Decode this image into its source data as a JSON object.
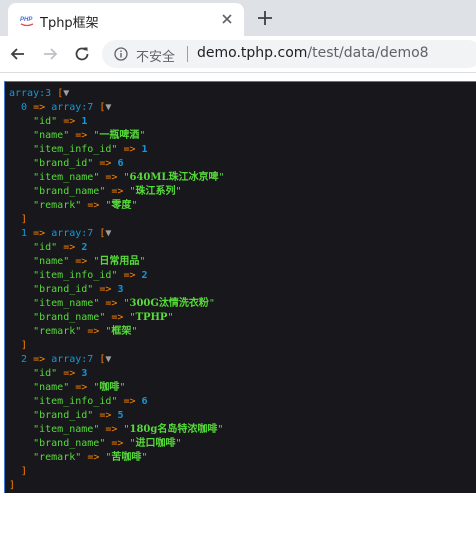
{
  "browser": {
    "tab_title": "Tphp框架",
    "favicon_text": "PHP",
    "security_label": "不安全",
    "url_host": "demo.tphp.com",
    "url_path": "/test/data/demo8"
  },
  "dump": {
    "root_type": "array:3",
    "items": [
      {
        "index": "0",
        "type": "array:7",
        "fields": [
          {
            "key": "id",
            "value": "1",
            "kind": "num"
          },
          {
            "key": "name",
            "value": "一瓶啤酒",
            "kind": "str"
          },
          {
            "key": "item_info_id",
            "value": "1",
            "kind": "num"
          },
          {
            "key": "brand_id",
            "value": "6",
            "kind": "num"
          },
          {
            "key": "item_name",
            "value": "640ML珠江冰京啤",
            "kind": "str"
          },
          {
            "key": "brand_name",
            "value": "珠江系列",
            "kind": "str"
          },
          {
            "key": "remark",
            "value": "零度",
            "kind": "str"
          }
        ]
      },
      {
        "index": "1",
        "type": "array:7",
        "fields": [
          {
            "key": "id",
            "value": "2",
            "kind": "num"
          },
          {
            "key": "name",
            "value": "日常用品",
            "kind": "str"
          },
          {
            "key": "item_info_id",
            "value": "2",
            "kind": "num"
          },
          {
            "key": "brand_id",
            "value": "3",
            "kind": "num"
          },
          {
            "key": "item_name",
            "value": "300G汰情洗衣粉",
            "kind": "str"
          },
          {
            "key": "brand_name",
            "value": "TPHP",
            "kind": "str"
          },
          {
            "key": "remark",
            "value": "框架",
            "kind": "str"
          }
        ]
      },
      {
        "index": "2",
        "type": "array:7",
        "fields": [
          {
            "key": "id",
            "value": "3",
            "kind": "num"
          },
          {
            "key": "name",
            "value": "咖啡",
            "kind": "str"
          },
          {
            "key": "item_info_id",
            "value": "6",
            "kind": "num"
          },
          {
            "key": "brand_id",
            "value": "5",
            "kind": "num"
          },
          {
            "key": "item_name",
            "value": "180g名岛特浓咖啡",
            "kind": "str"
          },
          {
            "key": "brand_name",
            "value": "进口咖啡",
            "kind": "str"
          },
          {
            "key": "remark",
            "value": "苦咖啡",
            "kind": "str"
          }
        ]
      }
    ]
  },
  "colors": {
    "dump_background": "#18171b",
    "key": "#56db3a",
    "number": "#1299da",
    "bracket": "#ff8400"
  }
}
